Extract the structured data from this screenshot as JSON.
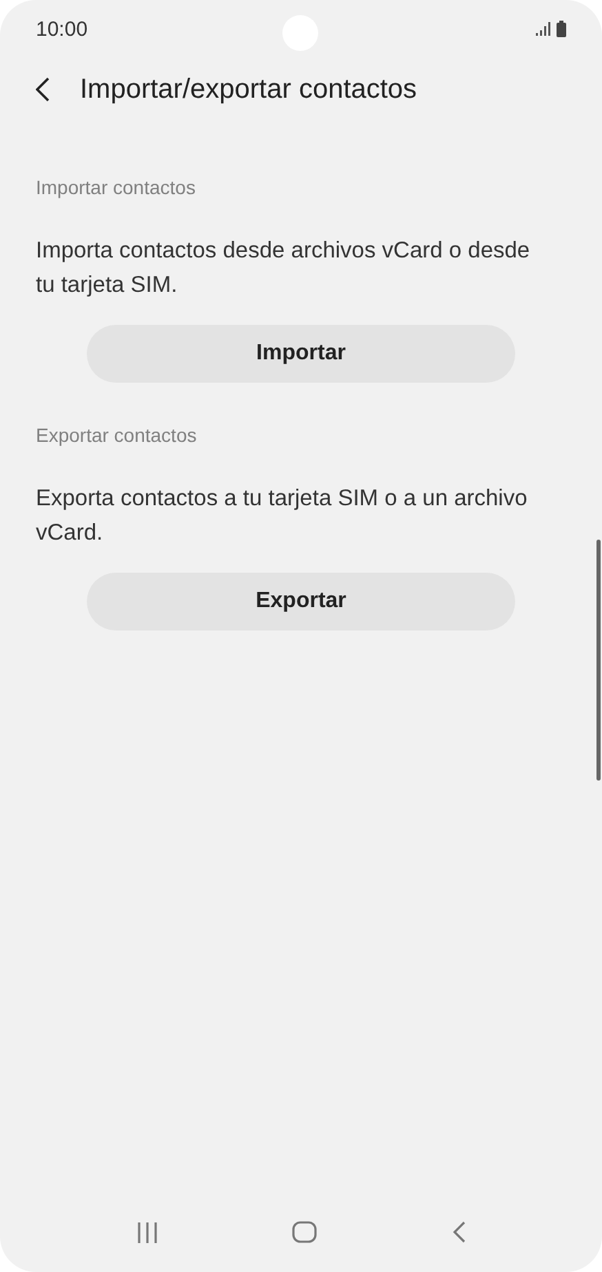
{
  "status_bar": {
    "time": "10:00"
  },
  "header": {
    "title": "Importar/exportar contactos"
  },
  "sections": [
    {
      "label": "Importar contactos",
      "description": "Importa contactos desde archivos vCard o desde tu tarjeta SIM.",
      "button": "Importar"
    },
    {
      "label": "Exportar contactos",
      "description": "Exporta contactos a tu tarjeta SIM o a un archivo vCard.",
      "button": "Exportar"
    }
  ]
}
